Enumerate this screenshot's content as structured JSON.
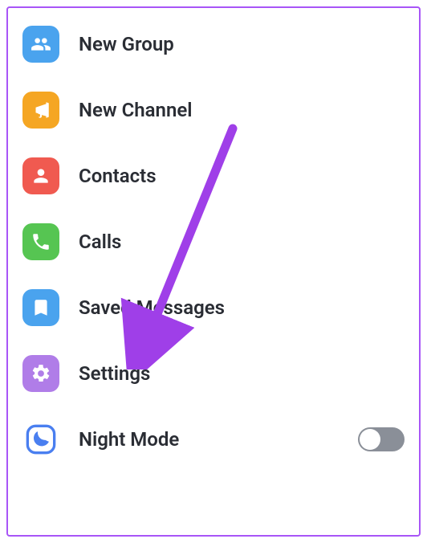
{
  "menu": {
    "newGroup": {
      "label": "New Group"
    },
    "newChannel": {
      "label": "New Channel"
    },
    "contacts": {
      "label": "Contacts"
    },
    "calls": {
      "label": "Calls"
    },
    "savedMessages": {
      "label": "Saved Messages"
    },
    "settings": {
      "label": "Settings"
    },
    "nightMode": {
      "label": "Night Mode",
      "enabled": false
    }
  },
  "annotation": {
    "arrow": {
      "target": "settings",
      "color": "#9f3fe8"
    }
  },
  "colors": {
    "border": "#a855f7",
    "text": "#2a2d34",
    "iconBlue": "#4aa3ee",
    "iconOrange": "#f5a623",
    "iconRed": "#f05a50",
    "iconGreen": "#56c552",
    "iconPurple": "#b07de8",
    "moonBlue": "#4a7ff0",
    "toggleOff": "#8a8f98"
  }
}
